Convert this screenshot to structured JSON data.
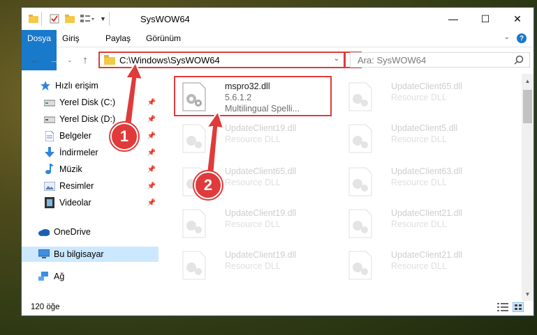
{
  "window": {
    "title": "SysWOW64",
    "controls": {
      "minimize": "—",
      "maximize": "☐",
      "close": "✕"
    }
  },
  "ribbon": {
    "tabs": [
      {
        "label": "Dosya",
        "active": true
      },
      {
        "label": "Giriş"
      },
      {
        "label": "Paylaş"
      },
      {
        "label": "Görünüm"
      }
    ],
    "help": "?"
  },
  "navigation": {
    "address": "C:\\Windows\\SysWOW64",
    "search_placeholder": "Ara: SysWOW64"
  },
  "sidebar": {
    "items": [
      {
        "label": "Hızlı erişim",
        "icon": "star-icon"
      },
      {
        "label": "Yerel Disk (C:)",
        "icon": "drive-icon",
        "pinned": true
      },
      {
        "label": "Yerel Disk (D:)",
        "icon": "drive-icon",
        "pinned": true
      },
      {
        "label": "Belgeler",
        "icon": "document-icon",
        "pinned": true
      },
      {
        "label": "İndirmeler",
        "icon": "download-icon",
        "pinned": true
      },
      {
        "label": "Müzik",
        "icon": "music-icon",
        "pinned": true
      },
      {
        "label": "Resimler",
        "icon": "pictures-icon",
        "pinned": true
      },
      {
        "label": "Videolar",
        "icon": "videos-icon",
        "pinned": true
      },
      {
        "label": "OneDrive",
        "icon": "cloud-icon"
      },
      {
        "label": "Bu bilgisayar",
        "icon": "computer-icon",
        "selected": true
      },
      {
        "label": "Ağ",
        "icon": "network-icon"
      }
    ]
  },
  "files": [
    {
      "name": "mspro32.dll",
      "line2": "5.6.1.2",
      "line3": "Multilingual Spelli...",
      "highlighted": true
    },
    {
      "name": "UpdateClient65.dll",
      "line2": "Resource DLL"
    },
    {
      "name": "UpdateClient19.dll",
      "line2": "Resource DLL"
    },
    {
      "name": "UpdateClient5.dll",
      "line2": "Resource DLL"
    },
    {
      "name": "UpdateClient65.dll",
      "line2": "Resource DLL"
    },
    {
      "name": "UpdateClient63.dll",
      "line2": "Resource DLL"
    },
    {
      "name": "UpdateClient19.dll",
      "line2": "Resource DLL"
    },
    {
      "name": "UpdateClient21.dll",
      "line2": "Resource DLL"
    },
    {
      "name": "UpdateClient19.dll",
      "line2": "Resource DLL"
    },
    {
      "name": "UpdateClient21.dll",
      "line2": "Resource DLL"
    }
  ],
  "status": {
    "item_count": "120 öğe"
  },
  "callouts": [
    {
      "number": "1"
    },
    {
      "number": "2"
    }
  ],
  "colors": {
    "accent": "#1979ca",
    "callout": "#e03a3a",
    "selection": "#cce8ff"
  }
}
